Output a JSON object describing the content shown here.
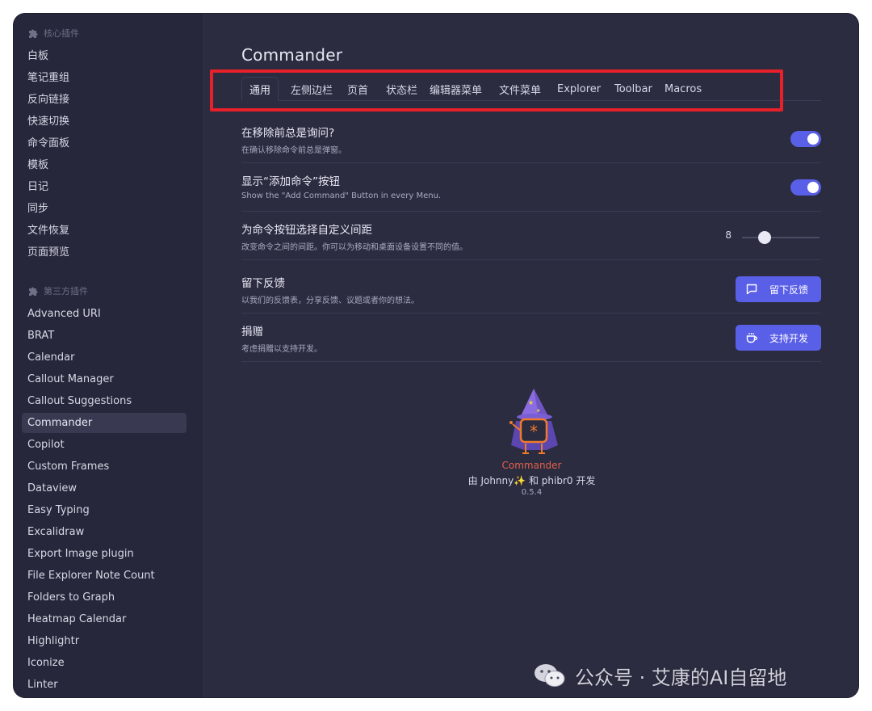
{
  "colors": {
    "accent": "#5a5fe8",
    "highlight_box": "#e8202a",
    "background": "#2b2c40",
    "sidebar": "#26273a",
    "mascot_name": "#e3604a"
  },
  "sidebar": {
    "core_title": "核心插件",
    "core_items": [
      "白板",
      "笔记重组",
      "反向链接",
      "快速切换",
      "命令面板",
      "模板",
      "日记",
      "同步",
      "文件恢复",
      "页面预览"
    ],
    "community_title": "第三方插件",
    "community_items": [
      "Advanced URI",
      "BRAT",
      "Calendar",
      "Callout Manager",
      "Callout Suggestions",
      "Commander",
      "Copilot",
      "Custom Frames",
      "Dataview",
      "Easy Typing",
      "Excalidraw",
      "Export Image plugin",
      "File Explorer Note Count",
      "Folders to Graph",
      "Heatmap Calendar",
      "Highlightr",
      "Iconize",
      "Linter"
    ],
    "active_item": "Commander"
  },
  "main": {
    "title": "Commander",
    "tabs": [
      "通用",
      "左侧边栏",
      "页首",
      "状态栏",
      "编辑器菜单",
      "文件菜单",
      "Explorer",
      "Toolbar",
      "Macros"
    ],
    "active_tab": "通用",
    "settings": [
      {
        "name": "在移除前总是询问?",
        "desc": "在确认移除命令前总是弹窗。",
        "control": "toggle",
        "enabled": true
      },
      {
        "name": "显示“添加命令”按钮",
        "desc": "Show the \"Add Command\" Button in every Menu.",
        "control": "toggle",
        "enabled": true
      },
      {
        "name": "为命令按钮选择自定义间距",
        "desc": "改变命令之间的间距。你可以为移动和桌面设备设置不同的值。",
        "control": "slider",
        "value": "8",
        "slider_fraction": 0.29
      },
      {
        "name": "留下反馈",
        "desc": "以我们的反馈表，分享反馈、议题或者你的想法。",
        "control": "button",
        "button_label": "留下反馈",
        "button_icon": "message-square-icon"
      },
      {
        "name": "捐赠",
        "desc": "考虑捐赠以支持开发。",
        "control": "button",
        "button_label": "支持开发",
        "button_icon": "coffee-cup-icon"
      }
    ],
    "footer": {
      "mascot_name": "Commander",
      "credit": "由 Johnny✨ 和 phibr0 开发",
      "version": "0.5.4"
    }
  },
  "watermark": {
    "text": "公众号 · 艾康的AI自留地",
    "icon": "wechat-icon"
  }
}
